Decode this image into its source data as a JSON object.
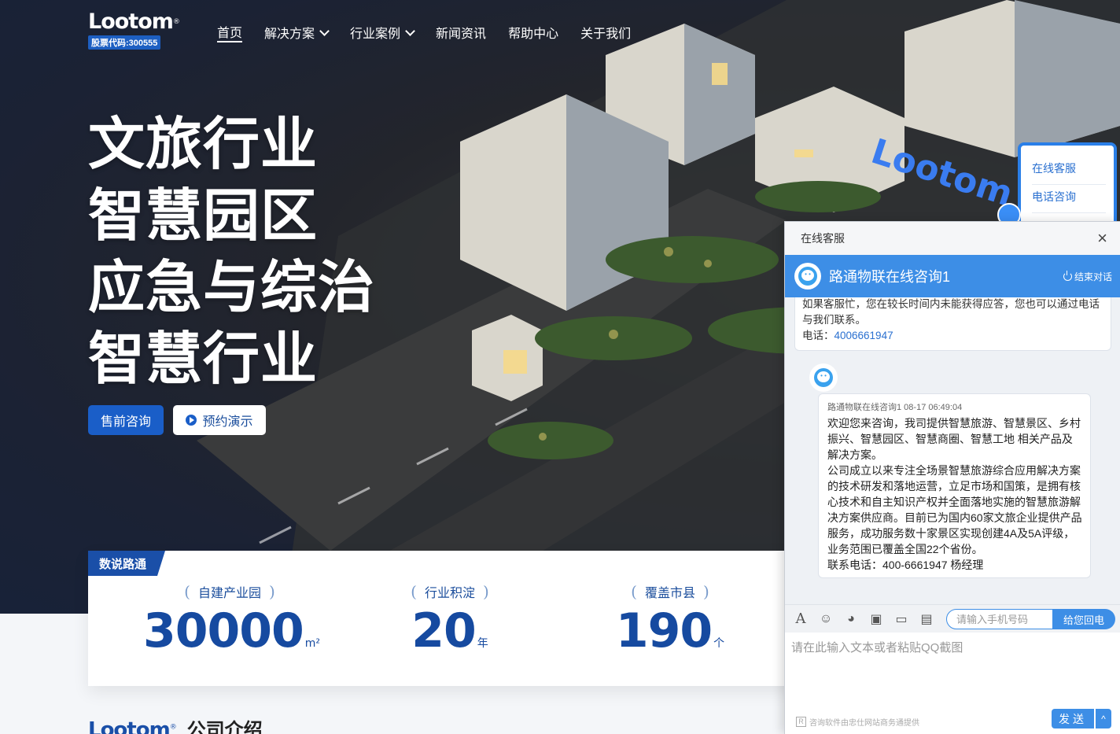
{
  "brand": {
    "logo_text": "Lootom",
    "logo_mark": "®",
    "stock_code": "股票代码:300555",
    "sign_text": "Lootom"
  },
  "nav": {
    "items": [
      {
        "label": "首页"
      },
      {
        "label": "解决方案"
      },
      {
        "label": "行业案例"
      },
      {
        "label": "新闻资讯"
      },
      {
        "label": "帮助中心"
      },
      {
        "label": "关于我们"
      }
    ]
  },
  "hero": {
    "lines": [
      "文旅行业",
      "智慧园区",
      "应急与综治",
      "智慧行业"
    ],
    "primary_button": "售前咨询",
    "secondary_button": "预约演示"
  },
  "stats": {
    "tag": "数说路通",
    "items": [
      {
        "label": "自建产业园",
        "value": "30000",
        "unit": "m²"
      },
      {
        "label": "行业积淀",
        "value": "20",
        "unit": "年"
      },
      {
        "label": "覆盖市县",
        "value": "190",
        "unit": "个"
      }
    ]
  },
  "section": {
    "title": "公司介绍"
  },
  "side_float": {
    "online": "在线客服",
    "phone": "电话咨询",
    "number": "400-6661947"
  },
  "chat": {
    "window_title": "在线客服",
    "agent_name": "路通物联在线咨询1",
    "end_label": "结束对话",
    "notice": "如果客服忙，您在较长时间内未能获得应答，您也可以通过电话与我们联系。",
    "notice_tel_label": "电话：",
    "notice_tel": "4006661947",
    "message_meta": "路通物联在线咨询1  08-17 06:49:04",
    "message_text": "欢迎您来咨询，我司提供智慧旅游、智慧景区、乡村振兴、智慧园区、智慧商圈、智慧工地 相关产品及解决方案。\n公司成立以来专注全场景智慧旅游综合应用解决方案的技术研发和落地运营，立足市场和国策，是拥有核心技术和自主知识产权并全面落地实施的智慧旅游解决方案供应商。目前已为国内60家文旅企业提供产品服务，成功服务数十家景区实现创建4A及5A评级，业务范围已覆盖全国22个省份。\n联系电话：400-6661947 杨经理",
    "phone_placeholder": "请输入手机号码",
    "call_button": "给您回电",
    "input_placeholder": "请在此输入文本或者粘贴QQ截图",
    "footer_note": "咨询软件由忠仕网站商务通提供",
    "send_button": "发送",
    "send_more": "^"
  }
}
